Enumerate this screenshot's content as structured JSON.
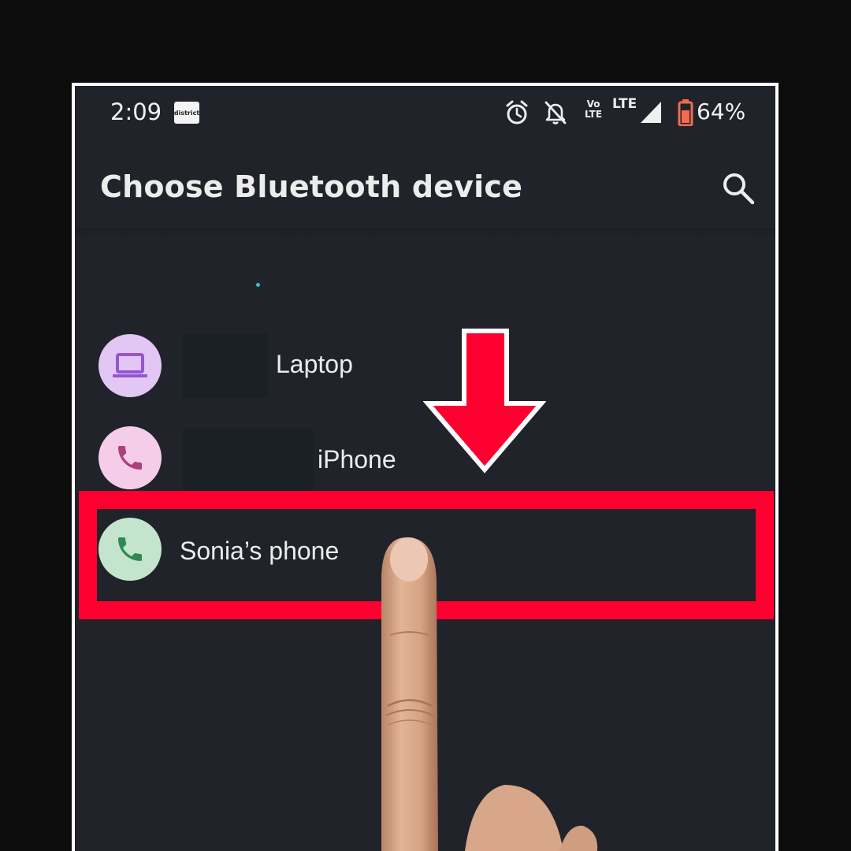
{
  "status_bar": {
    "time": "2:09",
    "notification_app_label": "district",
    "icons": [
      "alarm-icon",
      "bell-off-icon",
      "volte-icon",
      "lte-icon",
      "signal-icon",
      "battery-icon"
    ],
    "volte_text": "Vo LTE",
    "lte_text": "LTE",
    "battery_percent": "64%",
    "battery_level": 0.64,
    "battery_color": "#f26b4f"
  },
  "header": {
    "title": "Choose Bluetooth device",
    "search_icon": "search-icon"
  },
  "devices": [
    {
      "label": "Laptop",
      "icon": "laptop-icon",
      "icon_color": "#9556d1",
      "avatar_bg": "#e2c6f4",
      "redacted": true
    },
    {
      "label": "iPhone",
      "icon": "phone-icon",
      "icon_color": "#b03f7e",
      "avatar_bg": "#f6cde8",
      "redacted": true
    },
    {
      "label": "Sonia’s phone",
      "icon": "phone-icon",
      "icon_color": "#2e8a52",
      "avatar_bg": "#c5e4cd",
      "redacted": false
    }
  ],
  "annotations": {
    "highlight_color": "#fe0030",
    "arrow_direction": "down",
    "pointer": "finger-pointer"
  }
}
